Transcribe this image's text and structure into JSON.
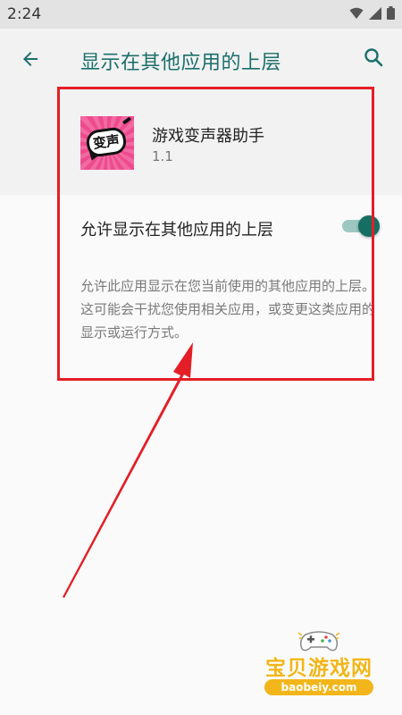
{
  "status_bar": {
    "time": "2:24",
    "icons": [
      "wifi-icon",
      "signal-icon",
      "battery-icon"
    ]
  },
  "app_bar": {
    "back_icon": "arrow-left-icon",
    "title": "显示在其他应用的上层",
    "search_icon": "search-icon",
    "accent_color": "#1b6f6b"
  },
  "app_info": {
    "name": "游戏变声器助手",
    "version": "1.1",
    "icon_text": "变声"
  },
  "permission": {
    "label": "允许显示在其他应用的上层",
    "enabled": true,
    "description": "允许此应用显示在您当前使用的其他应用的上层。这可能会干扰您使用相关应用，或变更这类应用的显示或运行方式。"
  },
  "watermark": {
    "title": "宝贝游戏网",
    "url": "baobeiy.com"
  },
  "colors": {
    "highlight": "#e41e26",
    "toggle_thumb": "#166e62",
    "toggle_track": "#9cc8c1"
  }
}
